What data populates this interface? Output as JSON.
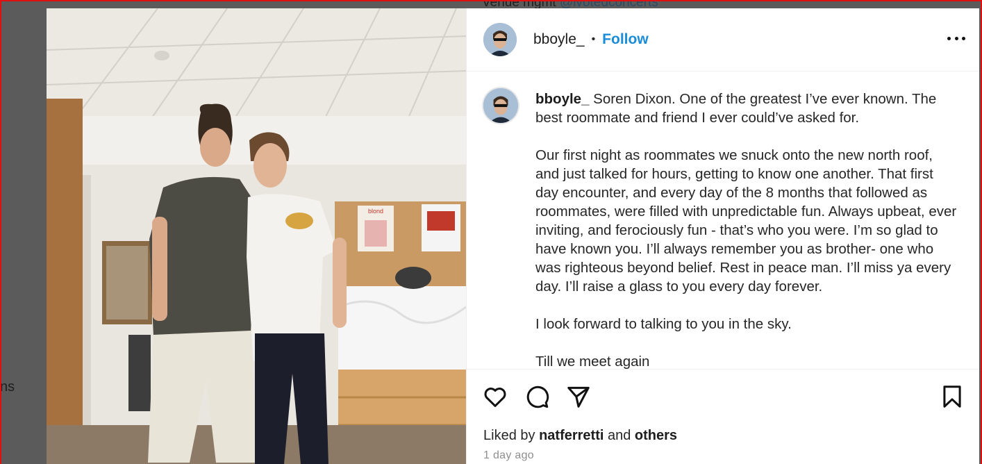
{
  "background": {
    "top_text_prefix": "Venue mgmt",
    "top_text_link": "@ivotedconcerts",
    "left_text": "ns"
  },
  "post": {
    "username": "bboyle_",
    "separator": "•",
    "follow_label": "Follow",
    "caption_username": "bboyle_",
    "caption_text": " Soren Dixon. One of the greatest I’ve ever known. The best roommate and friend I ever could’ve asked for.\n\nOur first night as roommates we snuck onto the new north roof, and just talked for hours, getting to know one another. That first day encounter, and every day of the 8 months that followed as roommates, were filled with unpredictable fun. Always upbeat, ever inviting, and ferociously fun - that’s who you were. I’m so glad to have known you. I’ll always remember you as brother- one who was righteous beyond belief. Rest in peace man. I’ll miss ya every day. I’ll raise a glass to you every day forever.\n\nI look forward to talking to you in the sky.\n\nTill we meet again",
    "likes_prefix": "Liked by",
    "likes_user": "natferretti",
    "likes_and": "and",
    "likes_others": "others",
    "timestamp": "1 day ago"
  },
  "photo": {
    "poster_label": "blond"
  },
  "icons": {
    "more": "more-options-icon",
    "like": "heart-icon",
    "comment": "comment-icon",
    "share": "paper-plane-icon",
    "save": "bookmark-icon"
  },
  "colors": {
    "follow": "#1a8cd8",
    "border": "#e01010",
    "timestamp": "#8e8e8e"
  }
}
